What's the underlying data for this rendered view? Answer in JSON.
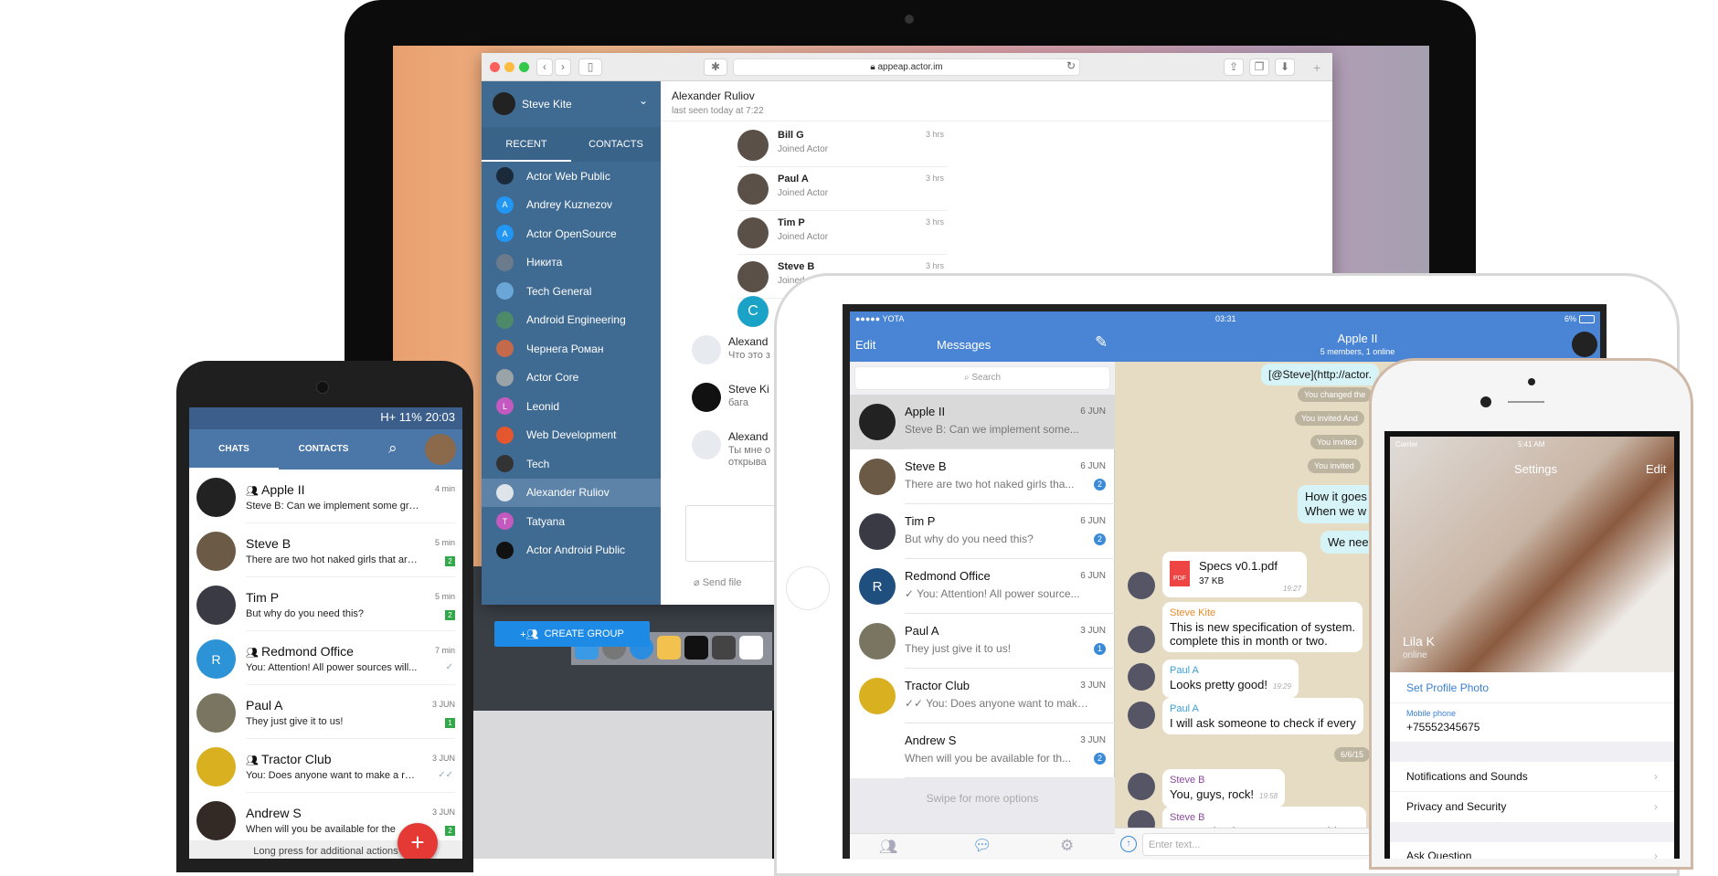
{
  "mac": {
    "url": "appeap.actor.im",
    "user": "Steve Kite",
    "tabs": [
      "RECENT",
      "CONTACTS"
    ],
    "sidebar": [
      {
        "label": "Actor Web Public",
        "color": "#1b2a3a",
        "initial": ""
      },
      {
        "label": "Andrey Kuznezov",
        "color": "#2196f3",
        "initial": "A"
      },
      {
        "label": "Actor OpenSource",
        "color": "#2196f3",
        "initial": "A"
      },
      {
        "label": "Никита",
        "color": "#6b7b8c",
        "initial": ""
      },
      {
        "label": "Tech General",
        "color": "#6aa7d8",
        "initial": ""
      },
      {
        "label": "Android Engineering",
        "color": "#4d8a6a",
        "initial": ""
      },
      {
        "label": "Чернега Роман",
        "color": "#c46a4a",
        "initial": ""
      },
      {
        "label": "Actor Core",
        "color": "#9aa3a8",
        "initial": ""
      },
      {
        "label": "Leonid",
        "color": "#c45ac0",
        "initial": "L"
      },
      {
        "label": "Web Development",
        "color": "#e4572e",
        "initial": ""
      },
      {
        "label": "Tech",
        "color": "#333",
        "initial": ""
      },
      {
        "label": "Alexander Ruliov",
        "color": "#dfe4ea",
        "initial": "",
        "selected": true
      },
      {
        "label": "Tatyana",
        "color": "#c45ac0",
        "initial": "T"
      },
      {
        "label": "Actor Android Public",
        "color": "#111",
        "initial": ""
      }
    ],
    "create_group": "CREATE GROUP",
    "chat_title": "Alexander Ruliov",
    "chat_status": "last seen today at 7:22",
    "members": [
      {
        "name": "Bill G",
        "sub": "Joined Actor",
        "time": "3 hrs"
      },
      {
        "name": "Paul A",
        "sub": "Joined Actor",
        "time": "3 hrs"
      },
      {
        "name": "Tim P",
        "sub": "Joined Actor",
        "time": "3 hrs"
      },
      {
        "name": "Steve B",
        "sub": "Joined Actor",
        "time": "3 hrs"
      }
    ],
    "c_initial": "C",
    "messages": [
      {
        "name": "Alexand",
        "text": "Что это з"
      },
      {
        "name": "Steve Ki",
        "text": "бага"
      },
      {
        "name": "Alexand",
        "text": "Ты мне о открыва"
      }
    ],
    "send_file": "Send file"
  },
  "android": {
    "status": "H+ 11% 20:03",
    "tabs": [
      "CHATS",
      "CONTACTS"
    ],
    "chats": [
      {
        "name": "Apple II",
        "group": true,
        "text": "Steve B: Can we implement some gra...",
        "time": "4 min",
        "badge": "",
        "color": "#222",
        "initial": ""
      },
      {
        "name": "Steve B",
        "group": false,
        "text": "There are two hot naked girls that are...",
        "time": "5 min",
        "badge": "2",
        "color": "#6b5a45",
        "initial": ""
      },
      {
        "name": "Tim P",
        "group": false,
        "text": "But why do you need this?",
        "time": "5 min",
        "badge": "2",
        "color": "#3a3a44",
        "initial": ""
      },
      {
        "name": "Redmond Office",
        "group": true,
        "text": "You: Attention! All power sources will...",
        "time": "7 min",
        "badge": "",
        "status": "✓",
        "color": "#2b93d6",
        "initial": "R"
      },
      {
        "name": "Paul A",
        "group": false,
        "text": "They just give it to us!",
        "time": "3 JUN",
        "badge": "1",
        "color": "#7a7560",
        "initial": ""
      },
      {
        "name": "Tractor Club",
        "group": true,
        "text": "You: Does anyone want to make a rac...",
        "time": "3 JUN",
        "badge": "",
        "status": "✓✓",
        "color": "#d9b020",
        "initial": ""
      },
      {
        "name": "Andrew S",
        "group": false,
        "text": "When will you be available for the",
        "time": "3 JUN",
        "badge": "2",
        "color": "#332a26",
        "initial": ""
      }
    ],
    "fab": "+",
    "hint": "Long press for additional actions"
  },
  "ipad": {
    "carrier": "●●●●● YOTA",
    "time": "03:31",
    "battery": "6%",
    "edit": "Edit",
    "title": "Messages",
    "search": "Search",
    "chats": [
      {
        "name": "Apple II",
        "text": "Steve B: Can we implement some...",
        "time": "6 JUN",
        "badge": "",
        "color": "#222",
        "initial": "",
        "selected": true
      },
      {
        "name": "Steve B",
        "text": "There are two hot naked girls tha...",
        "time": "6 JUN",
        "badge": "2",
        "color": "#6b5a45",
        "initial": ""
      },
      {
        "name": "Tim P",
        "text": "But why do you need this?",
        "time": "6 JUN",
        "badge": "2",
        "color": "#3a3a44",
        "initial": ""
      },
      {
        "name": "Redmond Office",
        "text": "✓ You: Attention! All power source...",
        "time": "6 JUN",
        "badge": "",
        "color": "#1f4f7f",
        "initial": "R"
      },
      {
        "name": "Paul A",
        "text": "They just give it to us!",
        "time": "3 JUN",
        "badge": "1",
        "color": "#7a7560",
        "initial": ""
      },
      {
        "name": "Tractor Club",
        "text": "✓✓ You: Does anyone want to make...",
        "time": "3 JUN",
        "badge": "",
        "color": "#d9b020",
        "initial": ""
      },
      {
        "name": "Andrew S",
        "text": "When will you be available for th...",
        "time": "3 JUN",
        "badge": "2",
        "color": "#fff",
        "initial": ""
      }
    ],
    "swipe": "Swipe for more options",
    "chat_title": "Apple II",
    "chat_sub": "5 members, 1 online",
    "link": "[@Steve](http://actor.",
    "sys": [
      "You changed the",
      "You invited And",
      "You invited",
      "You invited"
    ],
    "out": [
      "How it goes",
      "When we w",
      "We need"
    ],
    "file": {
      "name": "Specs v0.1.pdf",
      "size": "37 KB",
      "time": "19:27"
    },
    "msgs": [
      {
        "from": "Steve Kite",
        "color": "#e8892b",
        "text": "This is new specification of system.",
        "text2": "complete this in month or two.",
        "time": ""
      },
      {
        "from": "Paul A",
        "color": "#3aa0d8",
        "text": "Looks pretty good!",
        "time": "19:29"
      },
      {
        "from": "Paul A",
        "color": "#3aa0d8",
        "text": "I will ask someone to check if every",
        "time": ""
      },
      {
        "from": "Steve B",
        "color": "#8a4a9a",
        "text": "You, guys, rock!",
        "time": "19:58"
      },
      {
        "from": "Steve B",
        "color": "#8a4a9a",
        "text": "Can we implement some graphic ap",
        "time": ""
      }
    ],
    "date": "6/6/15",
    "input": "Enter text..."
  },
  "iphone": {
    "carrier": "Carrier",
    "time": "5:41 AM",
    "title": "Settings",
    "edit": "Edit",
    "name": "Lila K",
    "status": "online",
    "set_photo": "Set Profile Photo",
    "phone_label": "Mobile phone",
    "phone": "+75552345675",
    "items": [
      "Notifications and Sounds",
      "Privacy and Security"
    ],
    "ask": "Ask Question"
  },
  "colors": {
    "actor_blue": "#3f6a92",
    "ios_blue": "#4a85d5",
    "android_green": "#33a84b",
    "fab_red": "#e53935"
  }
}
